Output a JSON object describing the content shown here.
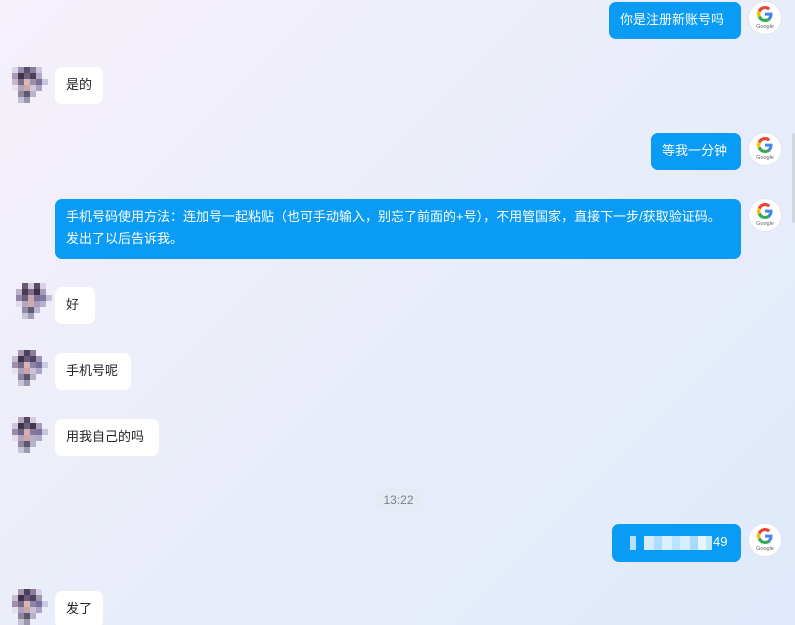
{
  "messages": [
    {
      "side": "self",
      "text": "你是注册新账号吗"
    },
    {
      "side": "other",
      "text": "是的"
    },
    {
      "side": "self",
      "text": "等我一分钟"
    },
    {
      "side": "self",
      "text": "手机号码使用方法：连加号一起粘贴（也可手动输入，别忘了前面的+号），不用管国家，直接下一步/获取验证码。发出了以后告诉我。"
    },
    {
      "side": "other",
      "text": "好"
    },
    {
      "side": "other",
      "text": "手机号呢"
    },
    {
      "side": "other",
      "text": "用我自己的吗"
    },
    {
      "side": "self",
      "text": "49",
      "note_visible": "phone number pixelated, only trailing digits visible"
    },
    {
      "side": "other",
      "text": "发了"
    }
  ],
  "time_separator": "13:22",
  "avatar": {
    "self_label": "Google",
    "self_icon": "google-g-icon",
    "other_icon": "pixelated-user-avatar"
  },
  "colors": {
    "self_bubble": "#0a9bf5",
    "other_bubble": "#ffffff"
  }
}
